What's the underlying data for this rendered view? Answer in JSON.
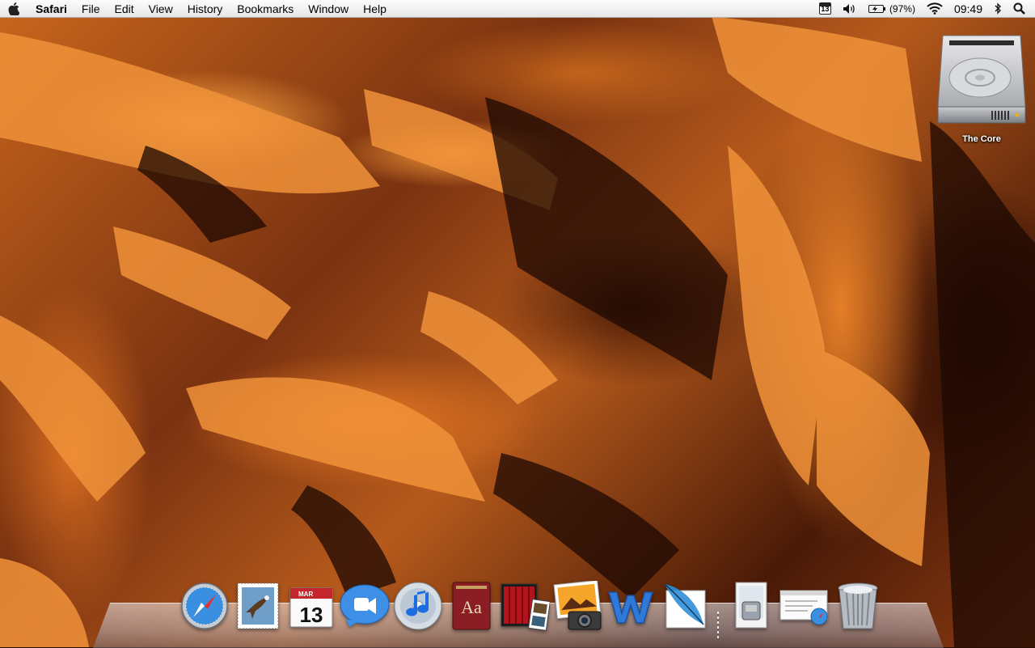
{
  "menubar": {
    "app_name": "Safari",
    "menus": [
      "File",
      "Edit",
      "View",
      "History",
      "Bookmarks",
      "Window",
      "Help"
    ],
    "status": {
      "calendar_day": "13",
      "battery_percent": "(97%)",
      "clock": "09:49"
    }
  },
  "desktop": {
    "icons": [
      {
        "label": "The Core",
        "icon": "hard-drive-icon"
      }
    ]
  },
  "dock": {
    "apps": [
      {
        "icon": "safari-icon"
      },
      {
        "icon": "mail-icon"
      },
      {
        "icon": "ical-icon",
        "month": "MAR",
        "day": "13"
      },
      {
        "icon": "facetime-icon"
      },
      {
        "icon": "itunes-icon"
      },
      {
        "icon": "dictionary-icon",
        "glyph": "Aa"
      },
      {
        "icon": "front-row-icon"
      },
      {
        "icon": "iphoto-icon"
      },
      {
        "icon": "word-icon"
      },
      {
        "icon": "photoshop-feather-icon"
      }
    ],
    "stacks": [
      {
        "icon": "applications-stack-icon"
      },
      {
        "icon": "documents-stack-icon"
      },
      {
        "icon": "trash-icon"
      }
    ]
  },
  "colors": {
    "menubar_top": "#fdfdfd",
    "menubar_bottom": "#e6e6e6",
    "wallpaper_light": "#e98a33",
    "wallpaper_dark": "#2a0f05"
  }
}
